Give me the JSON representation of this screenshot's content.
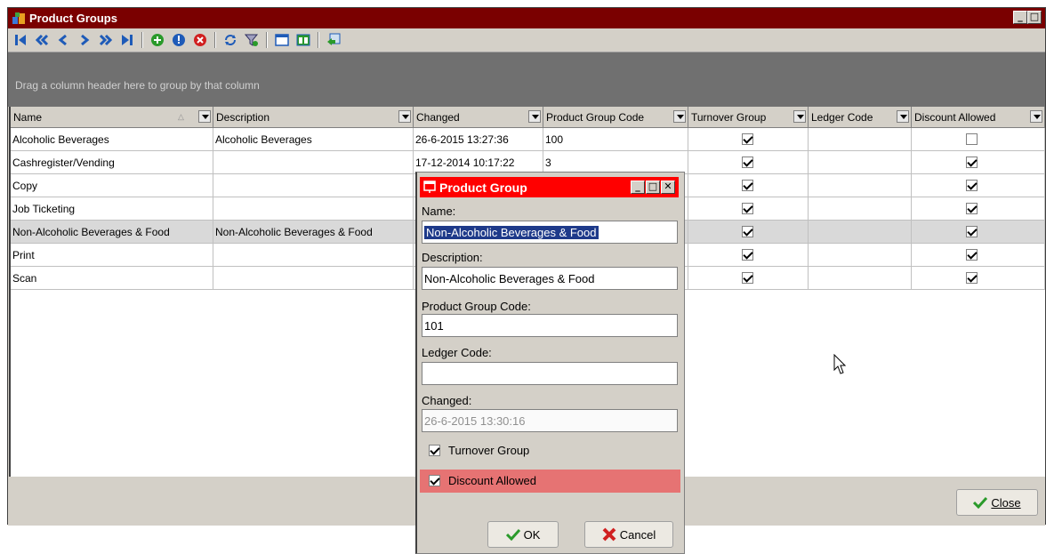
{
  "main": {
    "title": "Product Groups",
    "group_hint": "Drag a column header here to group by that column",
    "columns": [
      "Name",
      "Description",
      "Changed",
      "Product Group Code",
      "Turnover Group",
      "Ledger Code",
      "Discount Allowed"
    ],
    "rows": [
      {
        "name": "Alcoholic Beverages",
        "description": "Alcoholic Beverages",
        "changed": "26-6-2015 13:27:36",
        "code": "100",
        "turnover": true,
        "ledger": "",
        "discount": false
      },
      {
        "name": "Cashregister/Vending",
        "description": "",
        "changed": "17-12-2014 10:17:22",
        "code": "3",
        "turnover": true,
        "ledger": "",
        "discount": true
      },
      {
        "name": "Copy",
        "description": "",
        "changed": "",
        "code": "",
        "turnover": true,
        "ledger": "",
        "discount": true
      },
      {
        "name": "Job Ticketing",
        "description": "",
        "changed": "",
        "code": "",
        "turnover": true,
        "ledger": "",
        "discount": true
      },
      {
        "name": "Non-Alcoholic Beverages & Food",
        "description": "Non-Alcoholic Beverages & Food",
        "changed": "",
        "code": "",
        "turnover": true,
        "ledger": "",
        "discount": true
      },
      {
        "name": "Print",
        "description": "",
        "changed": "",
        "code": "",
        "turnover": true,
        "ledger": "",
        "discount": true
      },
      {
        "name": "Scan",
        "description": "",
        "changed": "",
        "code": "",
        "turnover": true,
        "ledger": "",
        "discount": true
      }
    ],
    "close_label": "Close"
  },
  "toolbar_icons": [
    "first-icon",
    "prev-page-icon",
    "prev-icon",
    "next-icon",
    "next-page-icon",
    "last-icon",
    "add-icon",
    "edit-icon",
    "delete-icon",
    "refresh-icon",
    "filter-icon",
    "view-icon",
    "columns-icon",
    "export-icon"
  ],
  "dialog": {
    "title": "Product Group",
    "name_label": "Name:",
    "name_value": "Non-Alcoholic Beverages & Food",
    "description_label": "Description:",
    "description_value": "Non-Alcoholic Beverages & Food",
    "code_label": "Product Group Code:",
    "code_value": "101",
    "ledger_label": "Ledger Code:",
    "ledger_value": "",
    "changed_label": "Changed:",
    "changed_value": "26-6-2015 13:30:16",
    "turnover_label": "Turnover Group",
    "turnover_checked": true,
    "discount_label": "Discount Allowed",
    "discount_checked": true,
    "ok_label": "OK",
    "cancel_label": "Cancel"
  },
  "colors": {
    "title_bar": "#7a0000",
    "dialog_title": "#ff0000",
    "highlight": "#e67373",
    "toolbar_icon": "#1e5bb8"
  }
}
